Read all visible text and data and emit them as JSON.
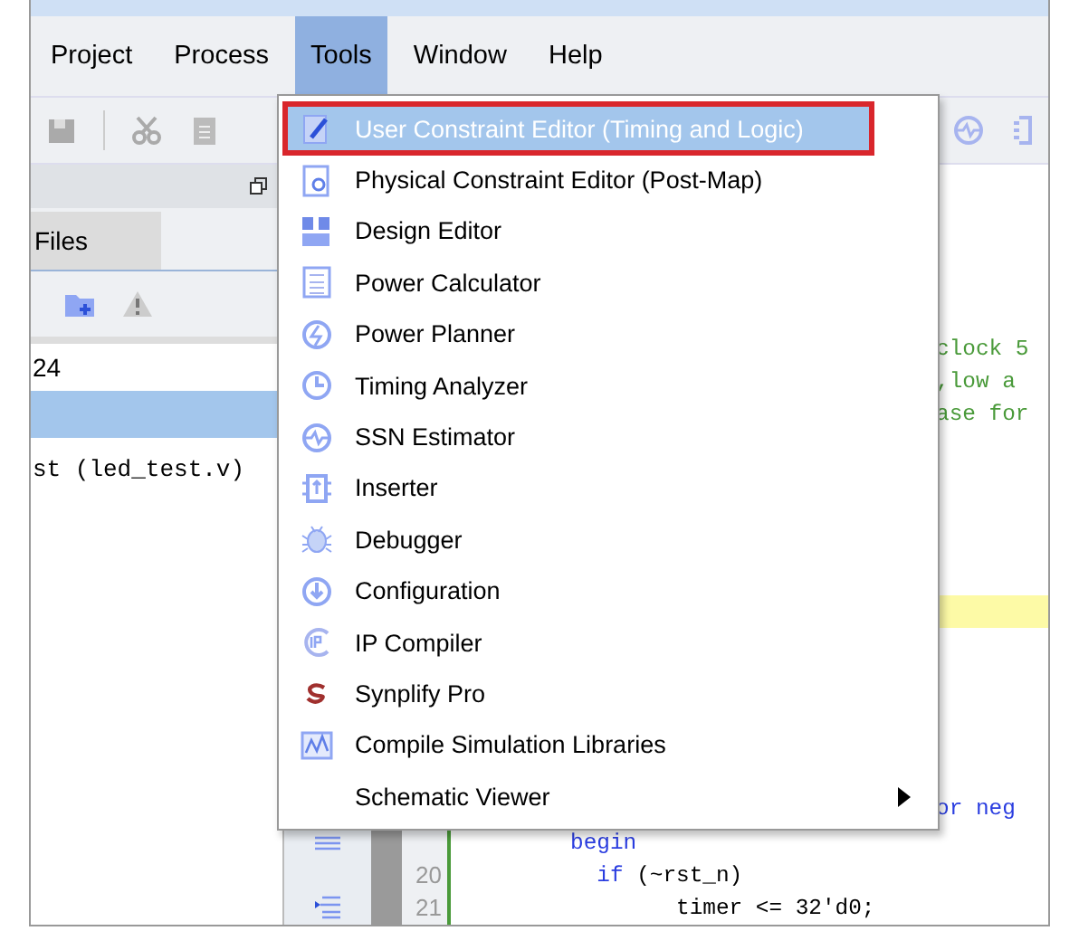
{
  "menu_bar": [
    {
      "label": "Project",
      "selected": false
    },
    {
      "label": "Process",
      "selected": false
    },
    {
      "label": "Tools",
      "selected": true
    },
    {
      "label": "Window",
      "selected": false
    },
    {
      "label": "Help",
      "selected": false
    }
  ],
  "left_panel": {
    "tab": {
      "label": "Files",
      "selected": true
    },
    "rows": [
      {
        "text": "24",
        "selected": false,
        "kind": "plain"
      },
      {
        "selected": true,
        "kind": "plain"
      },
      {
        "text": "st (led_test.v)",
        "selected": false,
        "kind": "mono"
      }
    ]
  },
  "editor": {
    "rows": [
      {
        "kind": "behind_menu",
        "segments": [
          {
            "text": "clock 5",
            "kind": "comment"
          }
        ]
      },
      {
        "kind": "behind_menu",
        "segments": [
          {
            "text": ",low a",
            "kind": "comment"
          }
        ]
      },
      {
        "kind": "behind_menu",
        "segments": [
          {
            "text": "ase for",
            "kind": "comment"
          }
        ]
      },
      {
        "kind": "behind_menu",
        "segments": [
          {
            "text": "or neg",
            "kind": "keyword"
          }
        ]
      },
      {
        "kind": "code",
        "segments": [
          {
            "text": "begin",
            "kind": "keyword"
          }
        ]
      },
      {
        "kind": "code",
        "number": "20",
        "segments": [
          {
            "text": "  if",
            "kind": "keyword"
          },
          {
            "text": " (~rst_n)",
            "kind": "plain"
          }
        ]
      },
      {
        "kind": "code",
        "number": "21",
        "segments": [
          {
            "text": "        timer <= 32'd0;",
            "kind": "plain"
          }
        ]
      }
    ]
  },
  "tools_menu": [
    {
      "label": "User Constraint Editor (Timing and Logic)",
      "selected": true
    },
    {
      "label": "Physical Constraint Editor (Post-Map)",
      "selected": false
    },
    {
      "label": "Design Editor",
      "selected": false
    },
    {
      "label": "Power Calculator",
      "selected": false
    },
    {
      "label": "Power Planner",
      "selected": false
    },
    {
      "label": "Timing Analyzer",
      "selected": false
    },
    {
      "label": "SSN Estimator",
      "selected": false
    },
    {
      "label": "Inserter",
      "selected": false
    },
    {
      "label": "Debugger",
      "selected": false
    },
    {
      "label": "Configuration",
      "selected": false
    },
    {
      "label": "IP Compiler",
      "selected": false
    },
    {
      "label": "Synplify Pro",
      "selected": false
    },
    {
      "label": "Compile Simulation Libraries",
      "selected": false
    },
    {
      "label": "Schematic Viewer",
      "selected": false,
      "has_submenu": true
    }
  ]
}
